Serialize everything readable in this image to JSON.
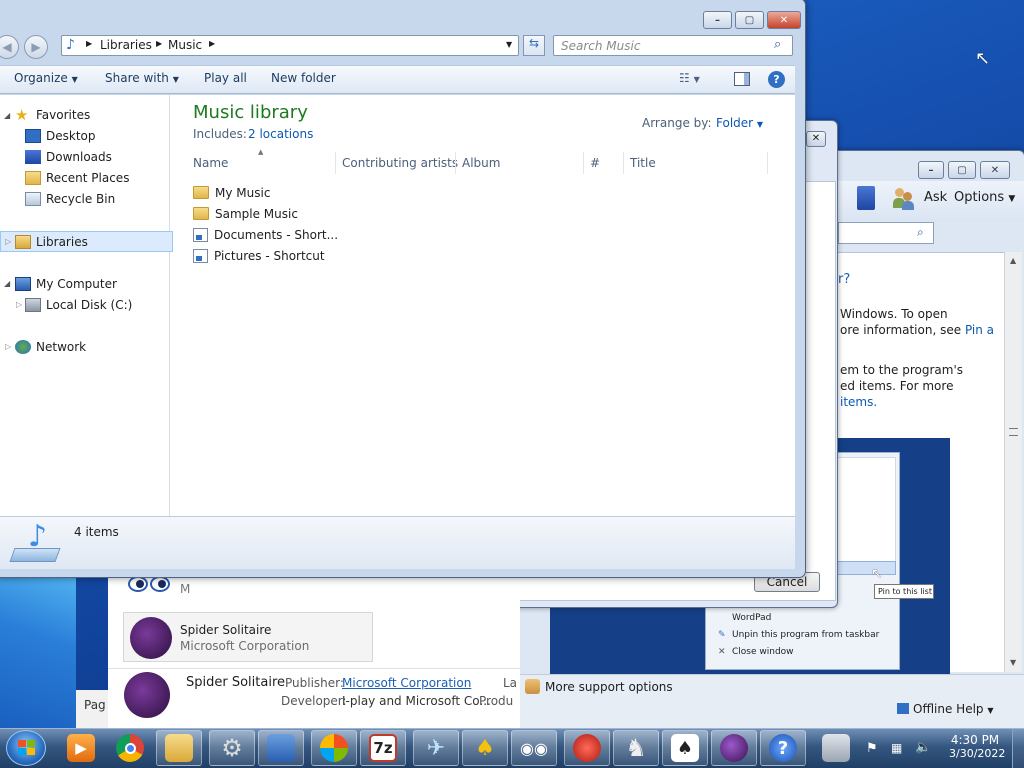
{
  "explorer": {
    "breadcrumb": [
      "Libraries",
      "Music"
    ],
    "search_placeholder": "Search Music",
    "commands": {
      "organize": "Organize",
      "share_with": "Share with",
      "play_all": "Play all",
      "new_folder": "New folder"
    },
    "nav": {
      "favorites": "Favorites",
      "desktop": "Desktop",
      "downloads": "Downloads",
      "recent_places": "Recent Places",
      "recycle_bin": "Recycle Bin",
      "libraries": "Libraries",
      "my_computer": "My Computer",
      "local_disk": "Local Disk (C:)",
      "network": "Network"
    },
    "library": {
      "title": "Music library",
      "includes_label": "Includes:",
      "includes_link": "2 locations",
      "arrange_label": "Arrange by:",
      "arrange_value": "Folder"
    },
    "columns": [
      "Name",
      "Contributing artists",
      "Album",
      "#",
      "Title"
    ],
    "files": [
      {
        "name": "My Music",
        "icon": "folder-icon"
      },
      {
        "name": "Sample Music",
        "icon": "folder-icon"
      },
      {
        "name": "Documents - Short...",
        "icon": "shortcut-icon"
      },
      {
        "name": "Pictures - Shortcut",
        "icon": "shortcut-icon"
      }
    ],
    "status": "4 items"
  },
  "help_window": {
    "toolbar": {
      "ask": "Ask",
      "options": "Options"
    },
    "question_tail": "r?",
    "para1": [
      "Windows. To open",
      "ore information, see "
    ],
    "para1_link": "Pin a",
    "para2": [
      "em to the program's",
      "ed items. For more"
    ],
    "para2_link": "items.",
    "jumplist": {
      "wordpad": "WordPad",
      "unpin": "Unpin this program from taskbar",
      "close": "Close window",
      "tooltip": "Pin to this list"
    },
    "more_support": "More support options",
    "offline_help": "Offline Help"
  },
  "dialog": {
    "cancel": "Cancel"
  },
  "store": {
    "card_title": "Spider Solitaire",
    "card_publisher": "Microsoft Corporation",
    "row_title": "Spider Solitaire",
    "publisher_label": "Publisher:",
    "publisher_value": "Microsoft Corporation",
    "developer_label": "Developer:",
    "developer_value": "I-play and Microsoft Co...",
    "cut_la": "La",
    "cut_produ": "Produ",
    "cut_m": "M",
    "cut_pag": "Pag"
  },
  "taskbar": {
    "time": "4:30 PM",
    "date": "3/30/2022",
    "apps": [
      "media-player-icon",
      "chrome-icon",
      "explorer-icon",
      "settings-icon",
      "control-panel-icon",
      "windows-update-icon",
      "7zip-icon",
      "mail-plane-icon",
      "paint-icon",
      "eyes-icon",
      "record-icon",
      "chess-icon",
      "solitaire-icon",
      "spider-icon",
      "help-icon",
      "device-icon"
    ]
  },
  "colors": {
    "accent": "#1e7a1e",
    "link": "#0b58b5",
    "taskbar": "#203f66"
  }
}
